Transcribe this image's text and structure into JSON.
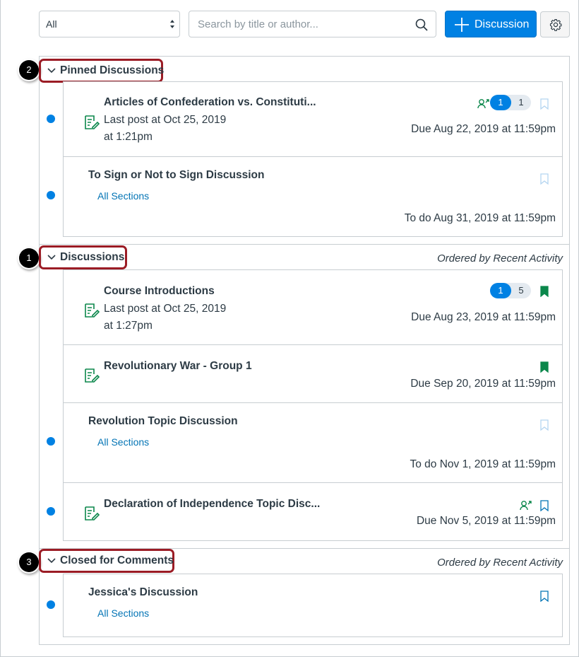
{
  "toolbar": {
    "filter_value": "All",
    "search_placeholder": "Search by title or author...",
    "add_label": "Discussion"
  },
  "callouts": [
    "2",
    "1",
    "3"
  ],
  "pinned": {
    "title": "Pinned Discussions",
    "items": [
      {
        "title": "Articles of Confederation vs. Constituti...",
        "last_post_line1": "Last post at Oct 25, 2019",
        "last_post_line2": "at 1:21pm",
        "unread": "1",
        "total": "1",
        "due": "Due Aug 22, 2019 at 11:59pm"
      },
      {
        "title": "To Sign or Not to Sign Discussion",
        "sections": "All Sections",
        "due": "To do Aug 31, 2019 at 11:59pm"
      }
    ]
  },
  "discussions": {
    "title": "Discussions",
    "ordered": "Ordered by Recent Activity",
    "items": [
      {
        "title": "Course Introductions",
        "last_post_line1": "Last post at Oct 25, 2019",
        "last_post_line2": "at 1:27pm",
        "unread": "1",
        "total": "5",
        "due": "Due Aug 23, 2019 at 11:59pm"
      },
      {
        "title": "Revolutionary War - Group 1",
        "due": "Due Sep 20, 2019 at 11:59pm"
      },
      {
        "title": "Revolution Topic Discussion",
        "sections": "All Sections",
        "due": "To do Nov 1, 2019 at 11:59pm"
      },
      {
        "title": "Declaration of Independence Topic Disc...",
        "due": "Due Nov 5, 2019 at 11:59pm"
      }
    ]
  },
  "closed": {
    "title": "Closed for Comments",
    "ordered": "Ordered by Recent Activity",
    "items": [
      {
        "title": "Jessica's Discussion",
        "sections": "All Sections"
      }
    ]
  },
  "colors": {
    "brand_blue": "#0081e3",
    "link_blue": "#0374b5",
    "assignment_green": "#0b874b",
    "bookmark_outline": "#b4d5f0",
    "highlight_red": "#9b1c25"
  },
  "icons": {
    "assignment": "assignment-edit-icon",
    "bookmark": "bookmark-icon",
    "peer_review": "peer-review-icon"
  }
}
